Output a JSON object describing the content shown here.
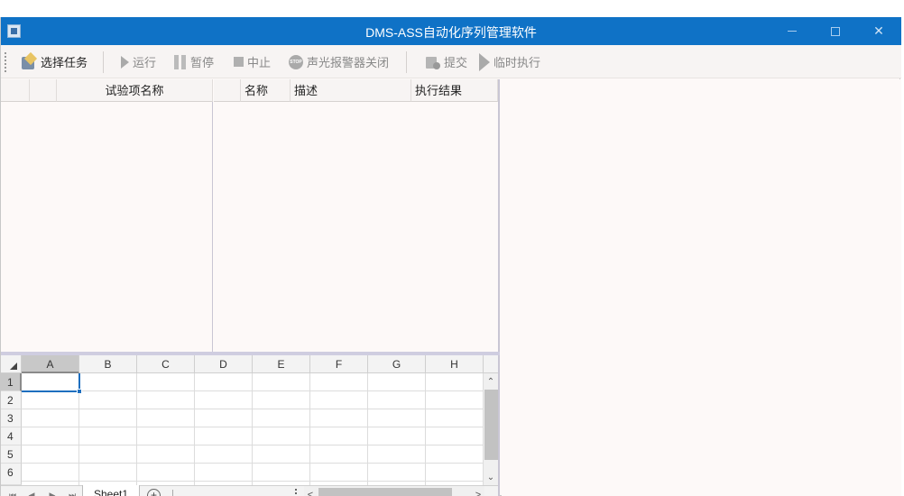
{
  "window": {
    "title": "DMS-ASS自动化序列管理软件",
    "controls": {
      "minimize": "—",
      "maximize": "☐",
      "close": "✕"
    }
  },
  "toolbar": {
    "select_task": "选择任务",
    "run": "运行",
    "pause": "暂停",
    "abort": "中止",
    "alarm_off": "声光报警器关闭",
    "submit": "提交",
    "temp_execute": "临时执行",
    "stop_glyph": "STOP"
  },
  "test_items_grid": {
    "columns": [
      "",
      "",
      "试验项名称"
    ],
    "rows": []
  },
  "results_grid": {
    "columns": [
      "",
      "名称",
      "描述",
      "执行结果"
    ],
    "rows": []
  },
  "spreadsheet": {
    "columns": [
      "A",
      "B",
      "C",
      "D",
      "E",
      "F",
      "G",
      "H"
    ],
    "rows": [
      "1",
      "2",
      "3",
      "4",
      "5",
      "6"
    ],
    "selected_cell": "A1",
    "sheet_tab": "Sheet1",
    "add_sheet": "+",
    "nav": {
      "first": "⏮",
      "prev": "◀",
      "next": "▶",
      "last": "⏭"
    },
    "scroll": {
      "up": "⌃",
      "down": "⌄",
      "left": "<",
      "right": ">"
    }
  },
  "colors": {
    "titlebar": "#0f72c6",
    "panel_bg": "#fdf9f8",
    "selection": "#1e6fbf"
  }
}
